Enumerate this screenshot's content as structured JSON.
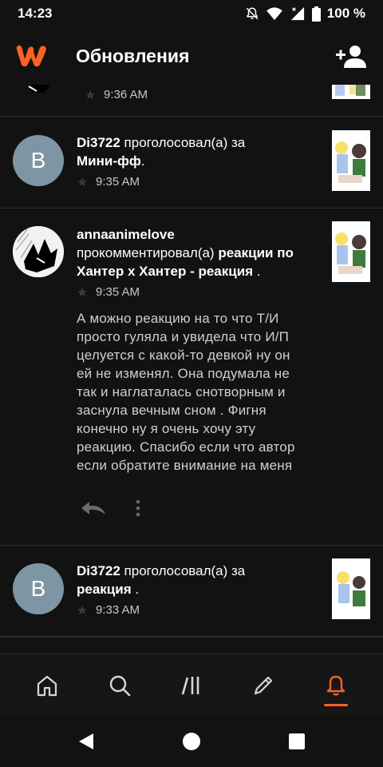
{
  "status": {
    "time": "14:23",
    "battery": "100 %"
  },
  "app_bar": {
    "title": "Обновления",
    "logo_icon": "wattpad-logo",
    "add_icon": "add-user-icon"
  },
  "feed": {
    "partial_time": "9:36 AM",
    "items": [
      {
        "avatar_letter": "B",
        "user": "Di3722",
        "action": " проголосовал(а) за",
        "target": "Мини-фф",
        "suffix": ".",
        "time": "9:35 AM"
      },
      {
        "user": "annaanimelove",
        "action": "прокомментировал(а) ",
        "target": "реакции по Хантер х Хантер - реакция",
        "suffix": " .",
        "time": "9:35 AM",
        "comment": "А можно реакцию на то что Т/И просто гуляла и увидела что И/П целуется с какой-то девкой ну он ей не изменял. Она подумала не так и наглаталась снотворным и заснула вечным сном . Фигня конечно ну я очень хочу эту реакцию. Спасибо если что автор если обратите внимание на меня"
      },
      {
        "avatar_letter": "B",
        "user": "Di3722",
        "action": " проголосовал(а) за",
        "target": "реакция",
        "suffix": " .",
        "time": "9:33 AM"
      }
    ]
  },
  "bottom_nav": {
    "items": [
      "home-icon",
      "search-icon",
      "library-icon",
      "write-icon",
      "notifications-icon"
    ],
    "active": "notifications-icon",
    "accent": "#ff6122"
  },
  "system_nav": [
    "back-icon",
    "home-circle-icon",
    "recents-icon"
  ]
}
